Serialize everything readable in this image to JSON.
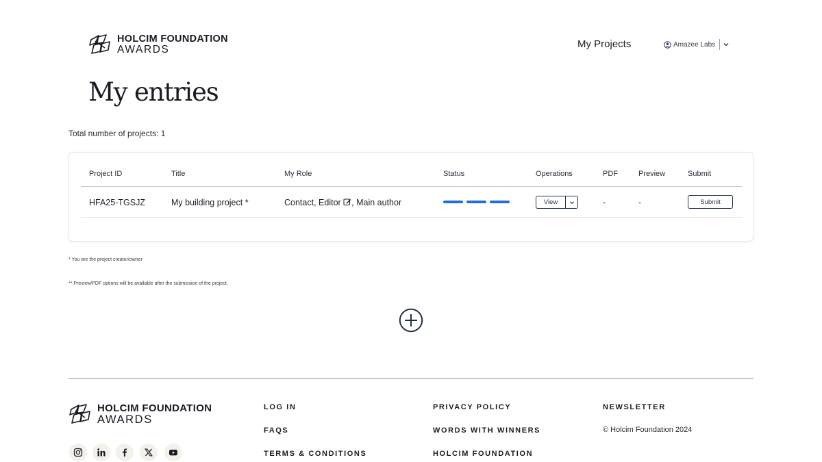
{
  "header": {
    "logo_line1": "HOLCIM FOUNDATION",
    "logo_line2": "AWARDS",
    "nav_link": "My Projects",
    "user_name": "Amazee Labs"
  },
  "main": {
    "title": "My entries",
    "total_label": "Total number of projects: 1",
    "table": {
      "columns": [
        "Project ID",
        "Title",
        "My Role",
        "Status",
        "Operations",
        "PDF",
        "Preview",
        "Submit"
      ],
      "rows": [
        {
          "project_id": "HFA25-TGSJZ",
          "title": "My building project *",
          "role_before": "Contact, Editor",
          "role_after": ", Main author",
          "status_segments": 3,
          "operation_label": "View",
          "pdf": "-",
          "preview": "-",
          "submit_label": "Submit"
        }
      ]
    },
    "note_owner": "* You are the project creator/owner",
    "note_preview": "** Preview/PDF options will be available after the submission of the project."
  },
  "footer": {
    "logo_line1": "HOLCIM FOUNDATION",
    "logo_line2": "AWARDS",
    "links_col1": [
      "LOG IN",
      "FAQS",
      "TERMS & CONDITIONS"
    ],
    "links_col2": [
      "PRIVACY POLICY",
      "WORDS WITH WINNERS",
      "HOLCIM FOUNDATION"
    ],
    "newsletter": "NEWSLETTER",
    "copyright": "© Holcim Foundation 2024",
    "social_icons": [
      "instagram-icon",
      "linkedin-icon",
      "facebook-icon",
      "x-icon",
      "youtube-icon"
    ]
  },
  "colors": {
    "accent_blue": "#1f6fe0",
    "navy": "#1f2d4d",
    "text": "#1e1e2a"
  }
}
